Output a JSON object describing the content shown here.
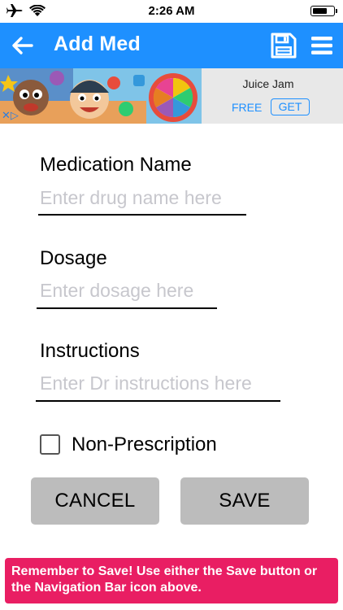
{
  "status_bar": {
    "time": "2:26 AM"
  },
  "app_bar": {
    "title": "Add Med",
    "color": "#1e90ff"
  },
  "ad": {
    "title": "Juice Jam",
    "free_label": "FREE",
    "get_label": "GET"
  },
  "form": {
    "medication_name": {
      "label": "Medication Name",
      "placeholder": "Enter drug name here",
      "value": ""
    },
    "dosage": {
      "label": "Dosage",
      "placeholder": "Enter dosage here",
      "value": ""
    },
    "instructions": {
      "label": "Instructions",
      "placeholder": "Enter Dr instructions here",
      "value": ""
    },
    "non_prescription": {
      "label": "Non-Prescription",
      "checked": false
    }
  },
  "buttons": {
    "cancel_label": "CANCEL",
    "save_label": "SAVE",
    "color": "#bcbcbc"
  },
  "footer": {
    "message": "Remember to Save! Use either the Save button or the Navigation Bar icon above.",
    "color": "#e91e63"
  },
  "battery": {
    "level": 0.75
  },
  "icons": [
    "airplane-icon",
    "wifi-icon",
    "battery-icon",
    "back-arrow-icon",
    "save-icon",
    "menu-icon",
    "ad-choices-icon"
  ]
}
